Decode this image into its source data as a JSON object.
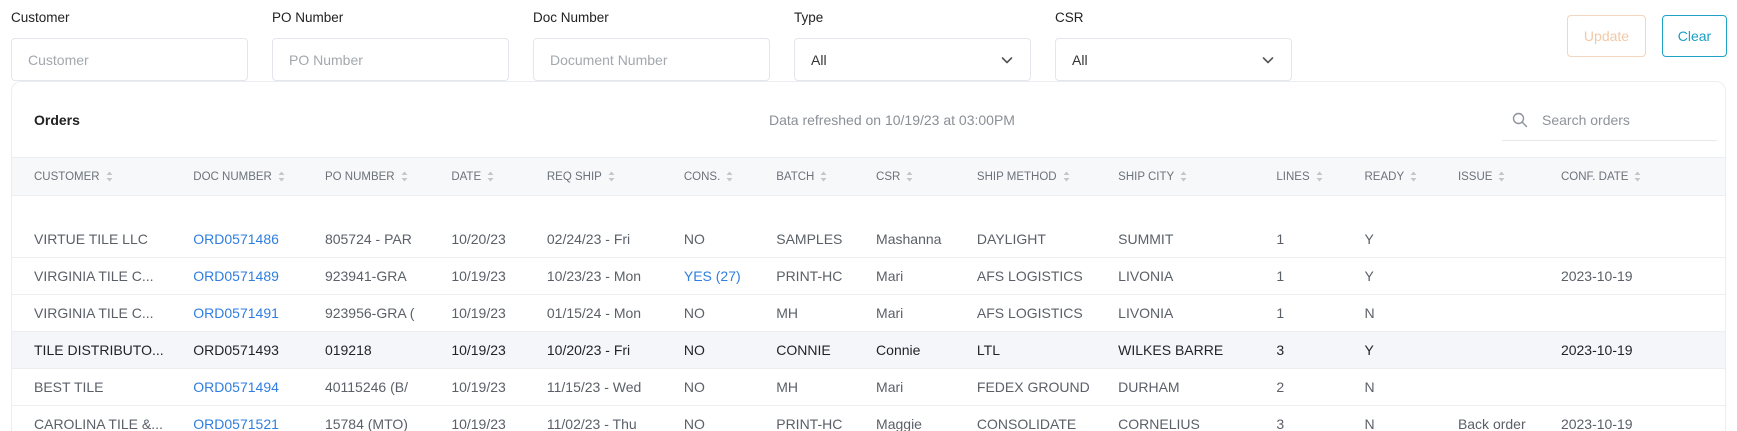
{
  "filters": {
    "customer": {
      "label": "Customer",
      "placeholder": "Customer",
      "value": ""
    },
    "po_number": {
      "label": "PO Number",
      "placeholder": "PO Number",
      "value": ""
    },
    "doc_number": {
      "label": "Doc Number",
      "placeholder": "Document Number",
      "value": ""
    },
    "type": {
      "label": "Type",
      "value": "All"
    },
    "csr": {
      "label": "CSR",
      "value": "All"
    },
    "update_label": "Update",
    "clear_label": "Clear"
  },
  "orders": {
    "title": "Orders",
    "refresh_text": "Data refreshed on 10/19/23 at 03:00PM",
    "search_placeholder": "Search orders",
    "columns": [
      "CUSTOMER",
      "DOC NUMBER",
      "PO NUMBER",
      "DATE",
      "REQ SHIP",
      "CONS.",
      "BATCH",
      "CSR",
      "SHIP METHOD",
      "SHIP CITY",
      "LINES",
      "READY",
      "ISSUE",
      "CONF. DATE"
    ],
    "rows": [
      {
        "customer": "VIRTUE TILE LLC",
        "doc": "ORD0571486",
        "po": "805724 - PAR",
        "date": "10/20/23",
        "req_ship": "02/24/23 - Fri",
        "cons": "NO",
        "batch": "SAMPLES",
        "csr": "Mashanna",
        "ship_method": "DAYLIGHT",
        "ship_city": "SUMMIT",
        "lines": "1",
        "ready": "Y",
        "issue": "",
        "conf_date": ""
      },
      {
        "customer": "VIRGINIA TILE C...",
        "doc": "ORD0571489",
        "po": "923941-GRA",
        "date": "10/19/23",
        "req_ship": "10/23/23 - Mon",
        "cons": "YES (27)",
        "batch": "PRINT-HC",
        "csr": "Mari",
        "ship_method": "AFS LOGISTICS",
        "ship_city": "LIVONIA",
        "lines": "1",
        "ready": "Y",
        "issue": "",
        "conf_date": "2023-10-19"
      },
      {
        "customer": "VIRGINIA TILE C...",
        "doc": "ORD0571491",
        "po": "923956-GRA (",
        "date": "10/19/23",
        "req_ship": "01/15/24 - Mon",
        "cons": "NO",
        "batch": "MH",
        "csr": "Mari",
        "ship_method": "AFS LOGISTICS",
        "ship_city": "LIVONIA",
        "lines": "1",
        "ready": "N",
        "issue": "",
        "conf_date": ""
      },
      {
        "customer": "TILE DISTRIBUTO...",
        "doc": "ORD0571493",
        "po": "019218",
        "date": "10/19/23",
        "req_ship": "10/20/23 - Fri",
        "cons": "NO",
        "batch": "CONNIE",
        "csr": "Connie",
        "ship_method": "LTL",
        "ship_city": "WILKES BARRE",
        "lines": "3",
        "ready": "Y",
        "issue": "",
        "conf_date": "2023-10-19"
      },
      {
        "customer": "BEST TILE",
        "doc": "ORD0571494",
        "po": "40115246 (B/",
        "date": "10/19/23",
        "req_ship": "11/15/23 - Wed",
        "cons": "NO",
        "batch": "MH",
        "csr": "Mari",
        "ship_method": "FEDEX GROUND",
        "ship_city": "DURHAM",
        "lines": "2",
        "ready": "N",
        "issue": "",
        "conf_date": ""
      },
      {
        "customer": "CAROLINA TILE &...",
        "doc": "ORD0571521",
        "po": "15784 (MTO)",
        "date": "10/19/23",
        "req_ship": "11/02/23 - Thu",
        "cons": "NO",
        "batch": "PRINT-HC",
        "csr": "Maggie",
        "ship_method": "CONSOLIDATE",
        "ship_city": "CORNELIUS",
        "lines": "3",
        "ready": "N",
        "issue": "Back order",
        "conf_date": "2023-10-19"
      }
    ]
  },
  "icons": {
    "search": "search-icon",
    "chevron": "chevron-down-icon",
    "sort": "sort-icon"
  },
  "colors": {
    "link": "#2f7ee0",
    "clear_button": "#1b9fc4",
    "update_button": "#f2c9a6"
  }
}
